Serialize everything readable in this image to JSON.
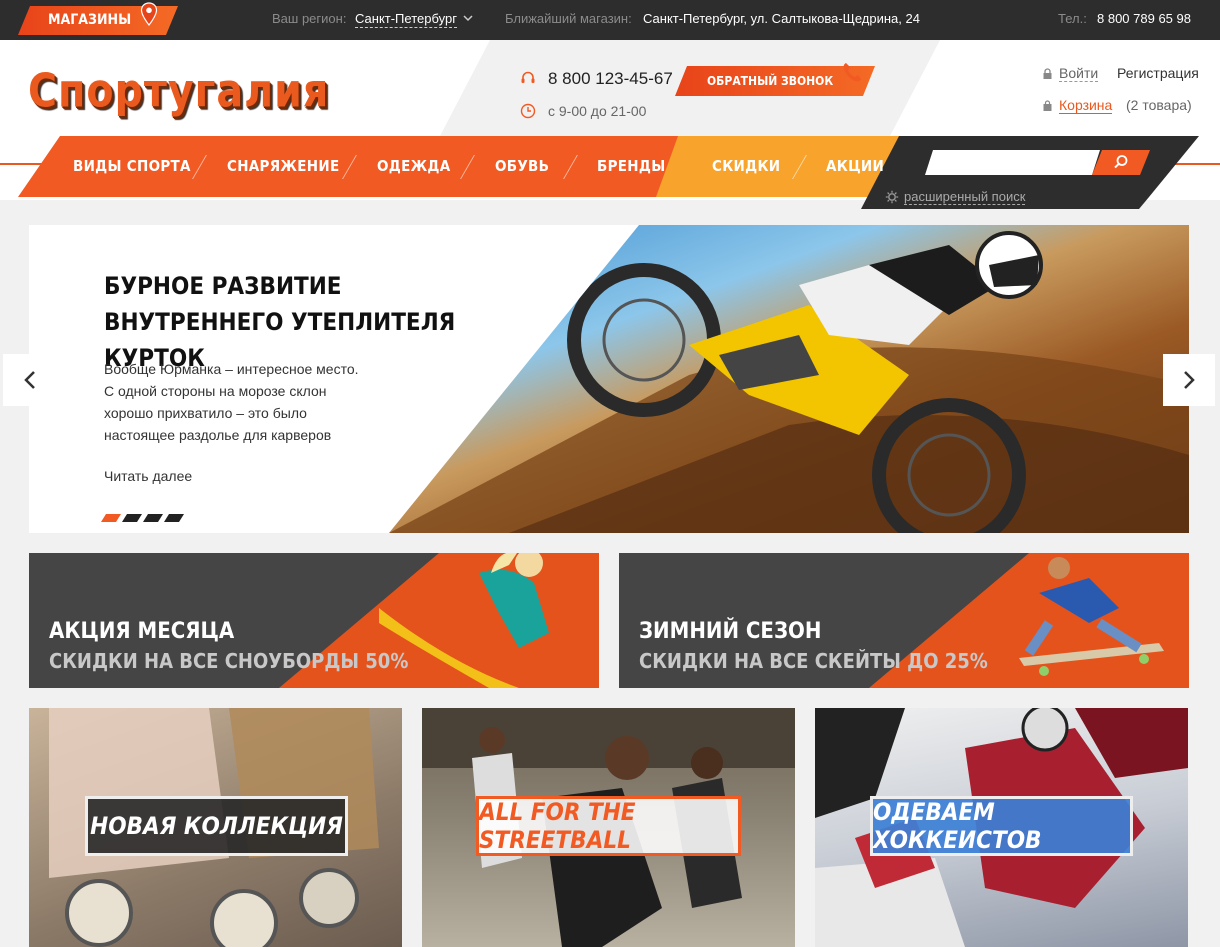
{
  "topbar": {
    "stores_label": "МАГАЗИНЫ",
    "region_label": "Ваш регион:",
    "region_value": "Санкт-Петербург",
    "nearest_label": "Ближайший магазин:",
    "nearest_value": "Санкт-Петербург, ул. Салтыкова-Щедрина, 24",
    "tel_label": "Тел.:",
    "tel_value": "8 800 789 65 98"
  },
  "header": {
    "logo": "Спортугалия",
    "phone": "8 800 123-45-67",
    "hours": "с 9-00 до 21-00",
    "callback_label": "ОБРАТНЫЙ ЗВОНОК",
    "login_label": "Войти",
    "register_label": "Регистрация",
    "cart_label": "Корзина",
    "cart_count": "(2 товара)"
  },
  "nav": {
    "items": [
      "ВИДЫ СПОРТА",
      "СНАРЯЖЕНИЕ",
      "ОДЕЖДА",
      "ОБУВЬ",
      "БРЕНДЫ",
      "СКИДКИ",
      "АКЦИИ"
    ],
    "advanced_search": "расширенный поиск"
  },
  "hero": {
    "title": "БУРНОЕ РАЗВИТИЕ ВНУТРЕННЕГО УТЕПЛИТЕЛЯ КУРТОК",
    "text": "Вообще Юрманка – интересное место. С одной стороны на морозе склон хорошо прихватило – это было настоящее раздолье для карверов",
    "more": "Читать далее",
    "slides_total": 4,
    "active_slide": 1
  },
  "banners": [
    {
      "line1": "АКЦИЯ МЕСЯЦА",
      "line2": "СКИДКИ НА ВСЕ СНОУБОРДЫ 50%"
    },
    {
      "line1": "ЗИМНИЙ СЕЗОН",
      "line2": "СКИДКИ НА ВСЕ СКЕЙТЫ ДО 25%"
    }
  ],
  "tiles": [
    {
      "label": "НОВАЯ КОЛЛЕКЦИЯ"
    },
    {
      "label": "ALL FOR THE STREETBALL"
    },
    {
      "label": "ОДЕВАЕМ ХОККЕИСТОВ"
    }
  ],
  "colors": {
    "accent": "#f15a22",
    "yellow": "#f7a32c",
    "dark": "#2d2d2d",
    "tile_blue": "#3d7fd6"
  },
  "icons": [
    "map-pin-icon",
    "chevron-down-icon",
    "headset-icon",
    "clock-icon",
    "handset-icon",
    "lock-icon",
    "bag-icon",
    "search-icon",
    "gear-icon",
    "arrow-left-icon",
    "arrow-right-icon"
  ]
}
